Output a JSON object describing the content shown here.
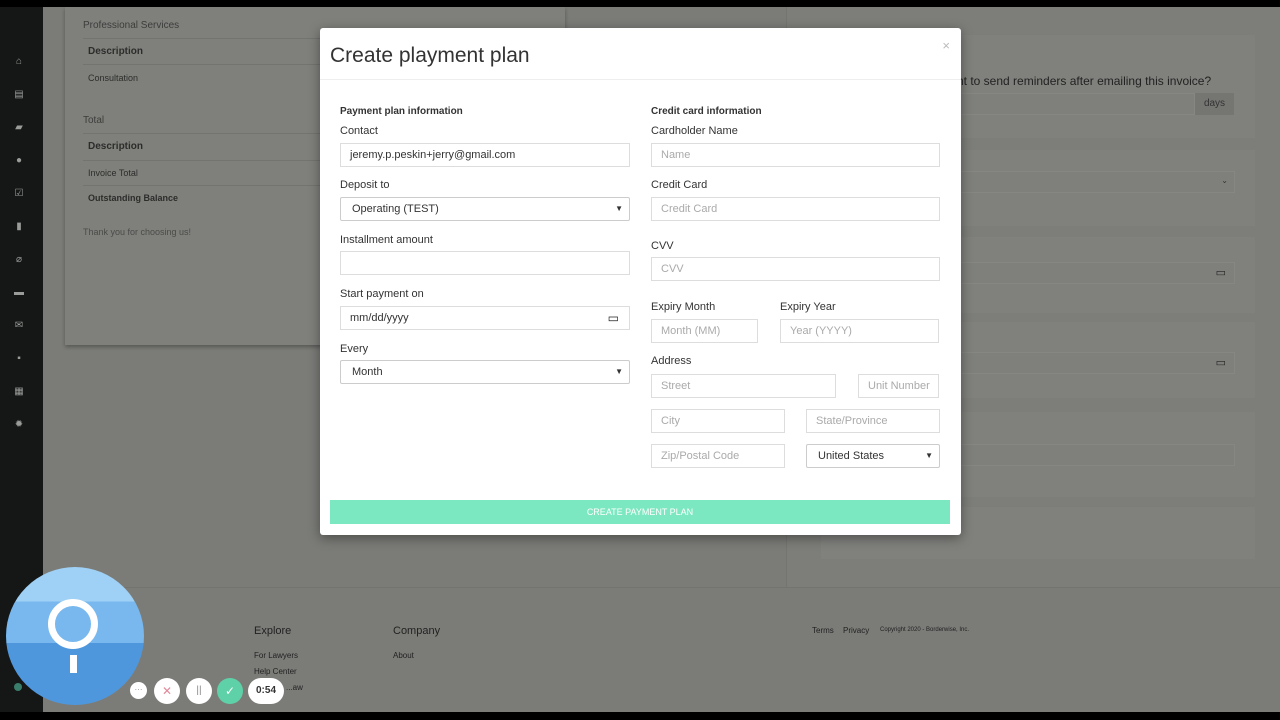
{
  "invoice": {
    "section1": "Professional Services",
    "header1": "Description",
    "row1": "Consultation",
    "section2": "Total",
    "header2": "Description",
    "row2": "Invoice Total",
    "row3": "Outstanding Balance",
    "thanks": "Thank you for choosing us!"
  },
  "right_panel": {
    "reminder_question": "...nt to send reminders after emailing this invoice?",
    "days_label": "days"
  },
  "sidebar": {
    "icons": [
      "home-icon",
      "document-icon",
      "folder-icon",
      "user-icon",
      "check-icon",
      "file-icon",
      "tag-icon",
      "card-icon",
      "mail-icon",
      "chat-icon",
      "calendar-icon",
      "gear-icon"
    ]
  },
  "modal": {
    "title": "Create playment plan",
    "close": "×",
    "left_section": "Payment plan information",
    "contact_label": "Contact",
    "contact_value": "jeremy.p.peskin+jerry@gmail.com",
    "deposit_label": "Deposit to",
    "deposit_value": "Operating (TEST)",
    "installment_label": "Installment amount",
    "installment_value": "",
    "start_label": "Start payment on",
    "start_placeholder": "mm/dd/yyyy",
    "every_label": "Every",
    "every_value": "Month",
    "right_section": "Credit card information",
    "cardholder_label": "Cardholder Name",
    "cardholder_placeholder": "Name",
    "card_label": "Credit Card",
    "card_placeholder": "Credit Card",
    "cvv_label": "CVV",
    "cvv_placeholder": "CVV",
    "exp_month_label": "Expiry Month",
    "exp_month_placeholder": "Month (MM)",
    "exp_year_label": "Expiry Year",
    "exp_year_placeholder": "Year (YYYY)",
    "address_label": "Address",
    "street_placeholder": "Street",
    "unit_placeholder": "Unit Number",
    "city_placeholder": "City",
    "state_placeholder": "State/Province",
    "zip_placeholder": "Zip/Postal Code",
    "country_value": "United States",
    "submit": "CREATE PAYMENT PLAN"
  },
  "footer": {
    "explore": "Explore",
    "for_lawyers": "For Lawyers",
    "help_center": "Help Center",
    "law": "...aw",
    "company": "Company",
    "about": "About",
    "terms": "Terms",
    "privacy": "Privacy",
    "copyright": "Copyright 2020 - Borderwise, Inc."
  },
  "recorder": {
    "more": "···",
    "cancel": "✕",
    "pause": "||",
    "done": "✓",
    "timer": "0:54"
  },
  "colors": {
    "accent": "#7ce8c1",
    "overlay": "#7b7c78"
  }
}
